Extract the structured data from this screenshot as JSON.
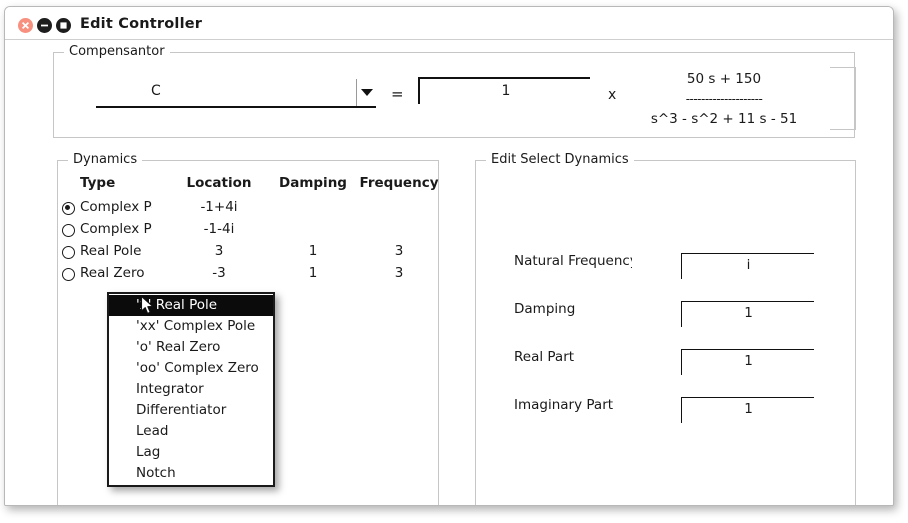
{
  "window": {
    "title": "Edit Controller",
    "buttons": {
      "close": "close-icon",
      "minimize": "minimize-icon",
      "maximize": "maximize-icon"
    },
    "colors": {
      "close": "#f7907f",
      "minimize": "#1d1d1d",
      "maximize": "#1d1d1d",
      "border": "#c6c6c6",
      "text": "#1a1a1a",
      "menu_highlight": "#0b0b0b"
    }
  },
  "compensator": {
    "title": "Compensantor",
    "selected": "C",
    "equals": "=",
    "gain": "1",
    "times": "x",
    "transfer_function": {
      "numerator": "50 s + 150",
      "bar": "--------------------",
      "denominator": "s^3 - s^2 + 11 s - 51"
    }
  },
  "dynamics": {
    "title": "Dynamics",
    "columns": [
      "Type",
      "Location",
      "Damping",
      "Frequency"
    ],
    "rows": [
      {
        "selected": true,
        "type": "Complex Pole",
        "location": "-1+4i",
        "damping": "",
        "frequency": ""
      },
      {
        "selected": false,
        "type": "Complex Pole",
        "location": "-1-4i",
        "damping": "",
        "frequency": ""
      },
      {
        "selected": false,
        "type": "Real Pole",
        "location": "3",
        "damping": "1",
        "frequency": "3"
      },
      {
        "selected": false,
        "type": "Real Zero",
        "location": "-3",
        "damping": "1",
        "frequency": "3"
      }
    ]
  },
  "edit_select_dynamics": {
    "title": "Edit Select Dynamics",
    "fields": [
      {
        "label": "Natural Frequency",
        "value": "i"
      },
      {
        "label": "Damping",
        "value": "1"
      },
      {
        "label": "Real Part",
        "value": "1"
      },
      {
        "label": "Imaginary Part",
        "value": "1"
      }
    ]
  },
  "context_menu": {
    "items": [
      {
        "label": "'x' Real Pole",
        "selected": true
      },
      {
        "label": "'xx' Complex Pole",
        "selected": false
      },
      {
        "label": "'o' Real Zero",
        "selected": false
      },
      {
        "label": "'oo' Complex Zero",
        "selected": false
      },
      {
        "label": "Integrator",
        "selected": false
      },
      {
        "label": "Differentiator",
        "selected": false
      },
      {
        "label": "Lead",
        "selected": false
      },
      {
        "label": "Lag",
        "selected": false
      },
      {
        "label": "Notch",
        "selected": false
      }
    ]
  }
}
